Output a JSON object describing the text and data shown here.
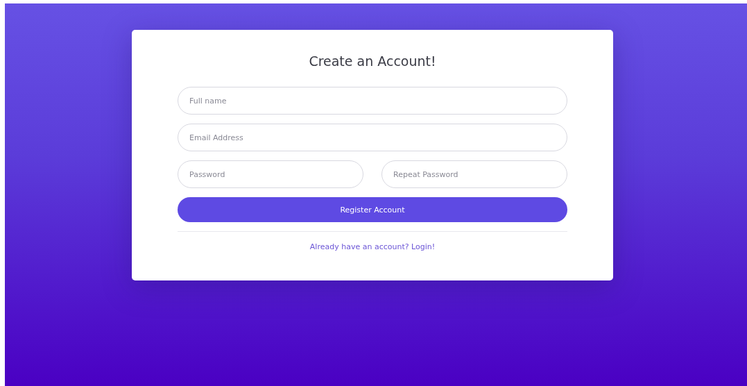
{
  "card": {
    "title": "Create an Account!",
    "fields": [
      {
        "placeholder": "Full name"
      },
      {
        "placeholder": "Email Address"
      }
    ],
    "password_fields": [
      {
        "placeholder": "Password"
      },
      {
        "placeholder": "Repeat Password"
      }
    ],
    "submit_button": "Register Account",
    "login_link": "Already have an account? Login!"
  }
}
